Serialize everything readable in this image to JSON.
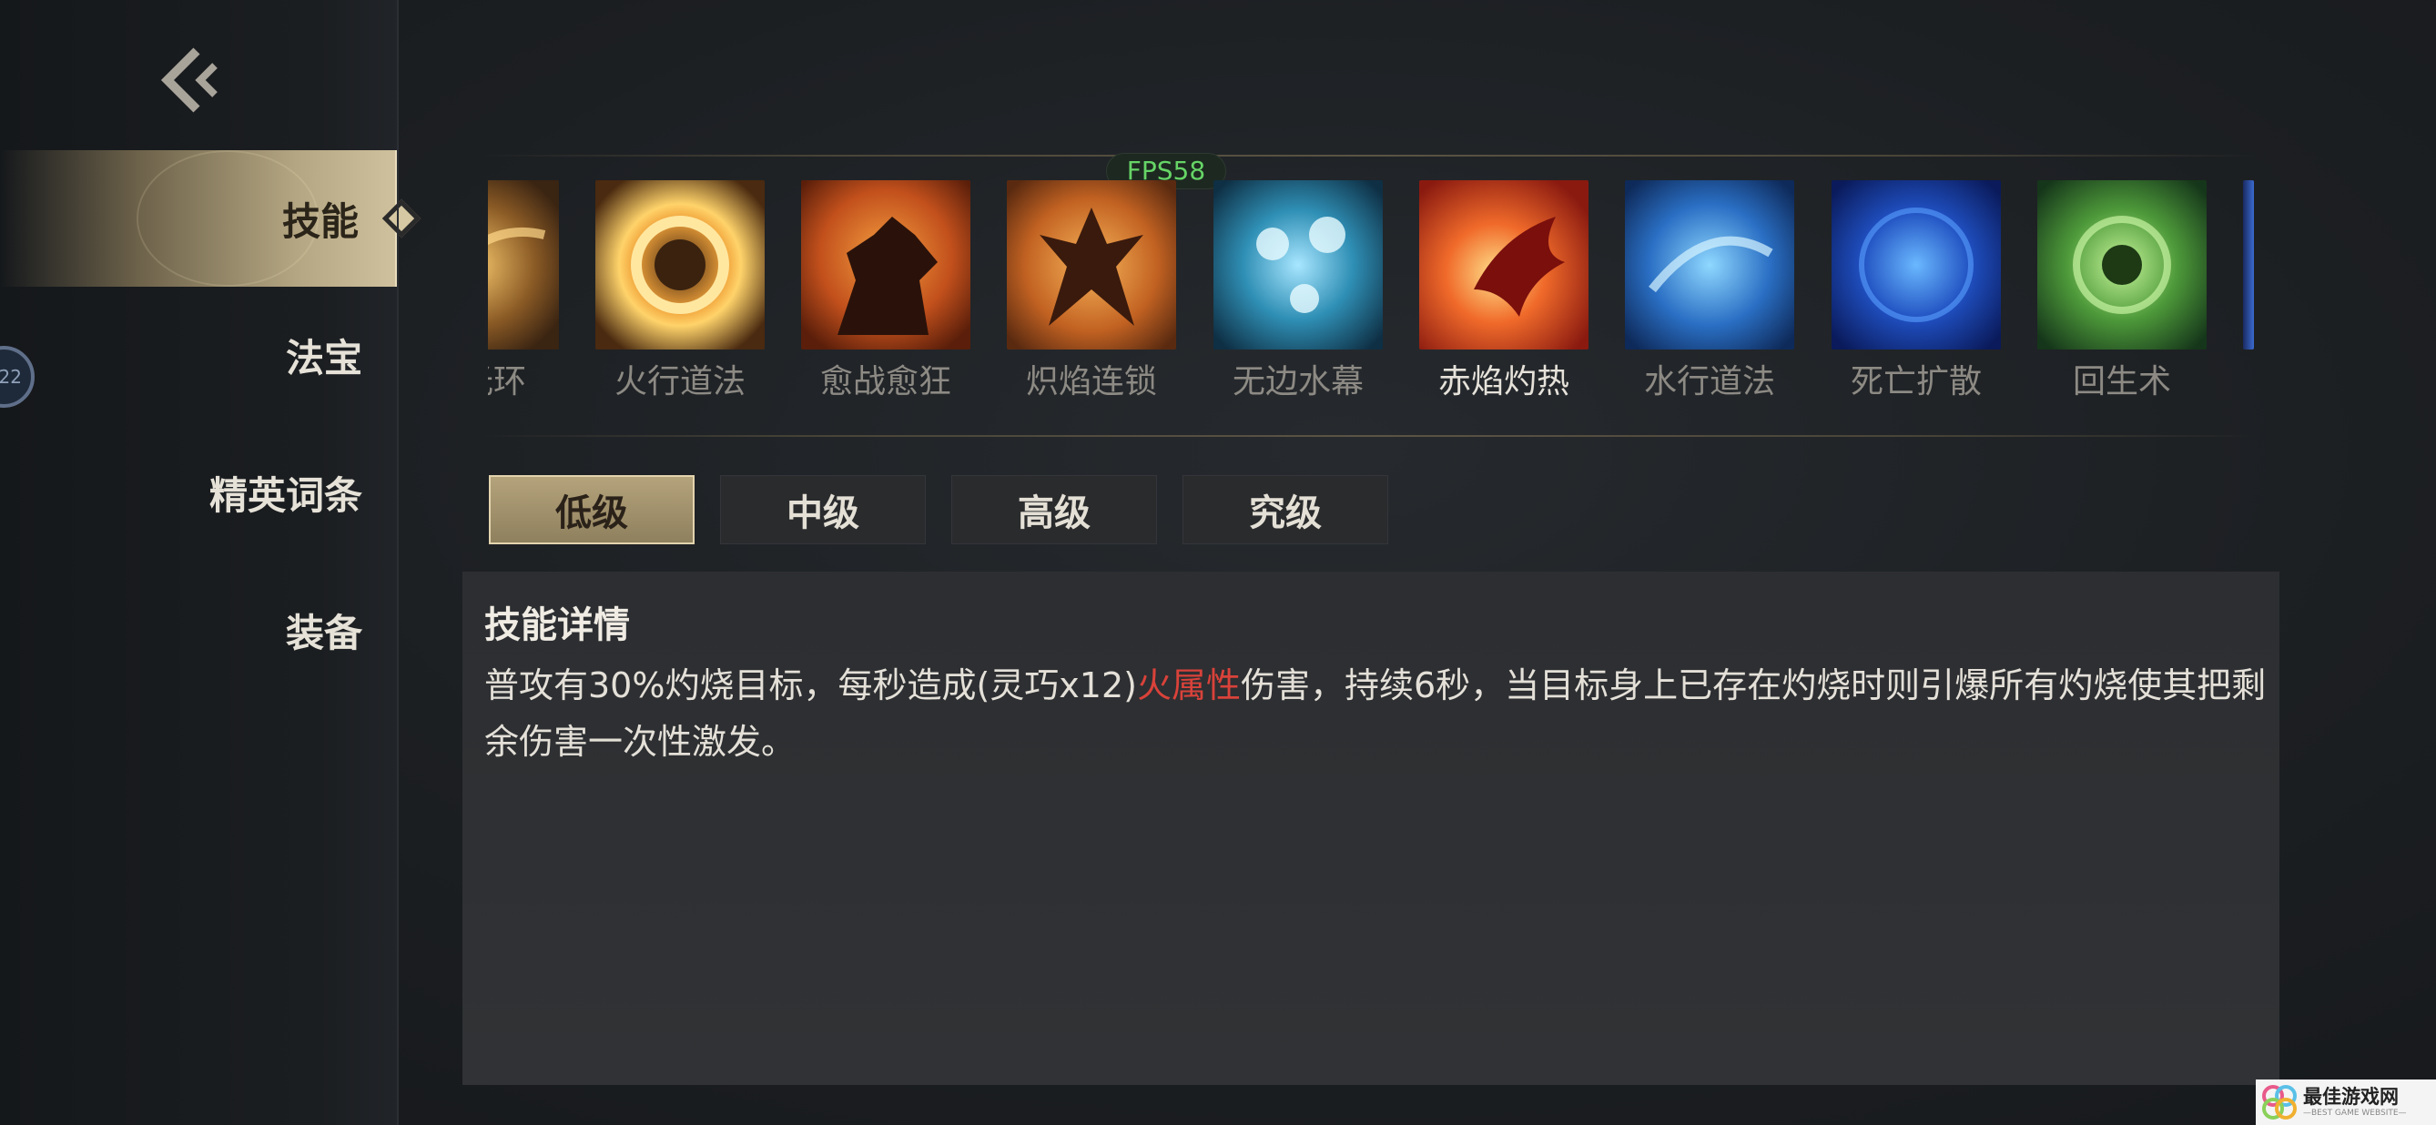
{
  "overlay": {
    "fps": "FPS58"
  },
  "sidebar": {
    "badge": "22",
    "items": [
      {
        "label": "技能",
        "active": true
      },
      {
        "label": "法宝",
        "active": false
      },
      {
        "label": "精英词条",
        "active": false
      },
      {
        "label": "装备",
        "active": false
      }
    ]
  },
  "skills": [
    {
      "label": "光环",
      "visible_label": "光环",
      "icon": "golden-aura-icon",
      "partial": true
    },
    {
      "label": "火行道法",
      "icon": "fire-ring-icon"
    },
    {
      "label": "愈战愈狂",
      "icon": "berserk-warrior-icon"
    },
    {
      "label": "炽焰连锁",
      "icon": "flame-chain-icon"
    },
    {
      "label": "无边水幕",
      "icon": "water-curtain-icon"
    },
    {
      "label": "赤焰灼热",
      "icon": "red-flame-dragon-icon",
      "active": true
    },
    {
      "label": "水行道法",
      "icon": "water-spell-icon"
    },
    {
      "label": "死亡扩散",
      "icon": "death-spread-icon"
    },
    {
      "label": "回生术",
      "icon": "revival-icon"
    }
  ],
  "levels": [
    {
      "label": "低级",
      "active": true
    },
    {
      "label": "中级",
      "active": false
    },
    {
      "label": "高级",
      "active": false
    },
    {
      "label": "究级",
      "active": false
    }
  ],
  "detail": {
    "title": "技能详情",
    "text_before": "普攻有30%灼烧目标，每秒造成(灵巧x12)",
    "highlight": "火属性",
    "text_after": "伤害，持续6秒，当目标身上已存在灼烧时则引爆所有灼烧使其把剩余伤害一次性激发。",
    "highlight_color": "#d9423a"
  },
  "watermark": {
    "main": "最佳游戏网",
    "sub": "—BEST GAME WEBSITE—"
  }
}
